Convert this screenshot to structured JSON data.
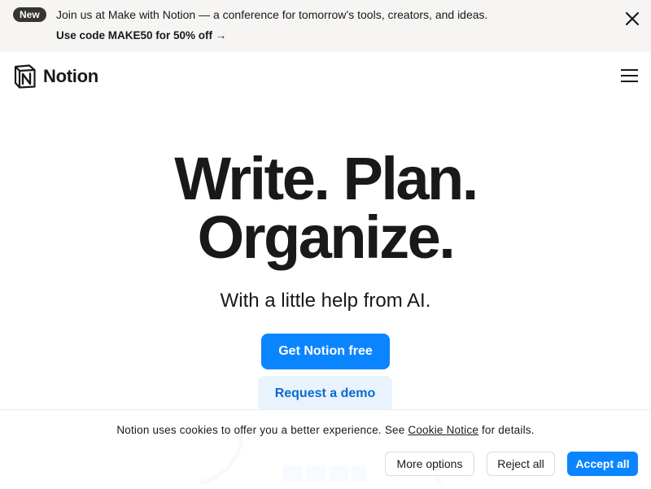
{
  "banner": {
    "badge": "New",
    "text": "Join us at Make with Notion — a conference for tomorrow’s tools, creators, and ideas.",
    "link": "Use code MAKE50 for 50% off →"
  },
  "header": {
    "logo_text": "Notion"
  },
  "hero": {
    "line1": "Write. Plan.",
    "line2": "Organize.",
    "subtitle": "With a little help from AI.",
    "primary_cta": "Get Notion free",
    "secondary_cta": "Request a demo"
  },
  "cookie": {
    "text_before": "Notion uses cookies to offer you a better experience. See",
    "link": "Cookie Notice",
    "text_after": "for details.",
    "more_options": "More options",
    "reject_all": "Reject all",
    "accept_all": "Accept all"
  },
  "colors": {
    "accent": "#0a85ff",
    "banner_bg": "#f6f5f4",
    "secondary_bg": "#e8f3fe"
  }
}
